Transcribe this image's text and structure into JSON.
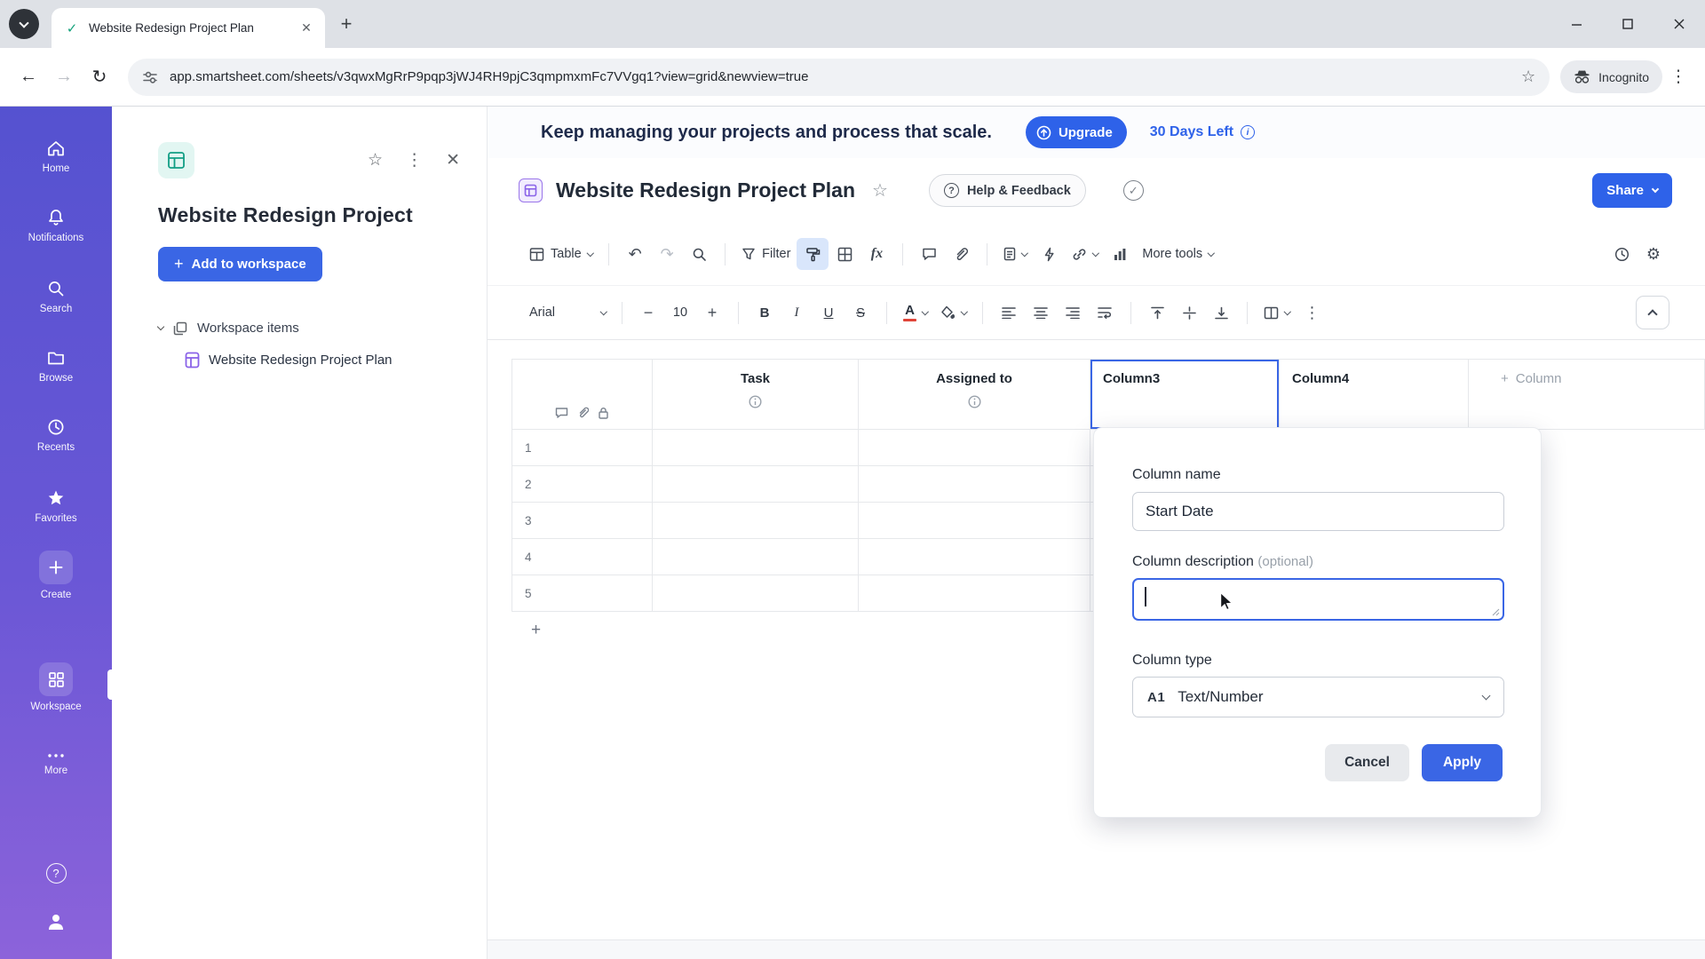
{
  "browser": {
    "tab_title": "Website Redesign Project Plan",
    "url": "app.smartsheet.com/sheets/v3qwxMgRrP9pqp3jWJ4RH9pjC3qmpmxmFc7VVgq1?view=grid&newview=true",
    "incognito_label": "Incognito"
  },
  "rail": {
    "items": [
      {
        "label": "Home"
      },
      {
        "label": "Notifications"
      },
      {
        "label": "Search"
      },
      {
        "label": "Browse"
      },
      {
        "label": "Recents"
      },
      {
        "label": "Favorites"
      },
      {
        "label": "Create"
      },
      {
        "label": "Workspace"
      },
      {
        "label": "More"
      }
    ]
  },
  "panel": {
    "title": "Website Redesign Project",
    "add_to_workspace": "Add to workspace",
    "workspace_items_label": "Workspace items",
    "sheet_item": "Website Redesign Project Plan"
  },
  "banner": {
    "message": "Keep managing your projects and process that scale.",
    "upgrade": "Upgrade",
    "days_left": "30 Days Left"
  },
  "sheet": {
    "title": "Website Redesign Project Plan",
    "help_feedback": "Help & Feedback",
    "share": "Share"
  },
  "toolbar": {
    "table": "Table",
    "filter": "Filter",
    "formula": "fx",
    "more_tools": "More tools"
  },
  "format": {
    "font_name": "Arial",
    "font_size": "10"
  },
  "grid": {
    "columns": {
      "task": "Task",
      "assigned": "Assigned to",
      "col3": "Column3",
      "col4": "Column4"
    },
    "add_column": "Column",
    "rows": [
      "1",
      "2",
      "3",
      "4",
      "5"
    ]
  },
  "dialog": {
    "column_name_label": "Column name",
    "column_name_value": "Start Date",
    "description_label": "Column description",
    "description_optional": "(optional)",
    "column_type_label": "Column type",
    "type_abbr": "A1",
    "type_value": "Text/Number",
    "cancel": "Cancel",
    "apply": "Apply"
  },
  "colors": {
    "accent_blue": "#2e62e9",
    "selection_blue": "#3a66e5",
    "rail_gradient_top": "#5552d0",
    "rail_gradient_bottom": "#8c63da",
    "banner_text": "#1e2a4a"
  }
}
